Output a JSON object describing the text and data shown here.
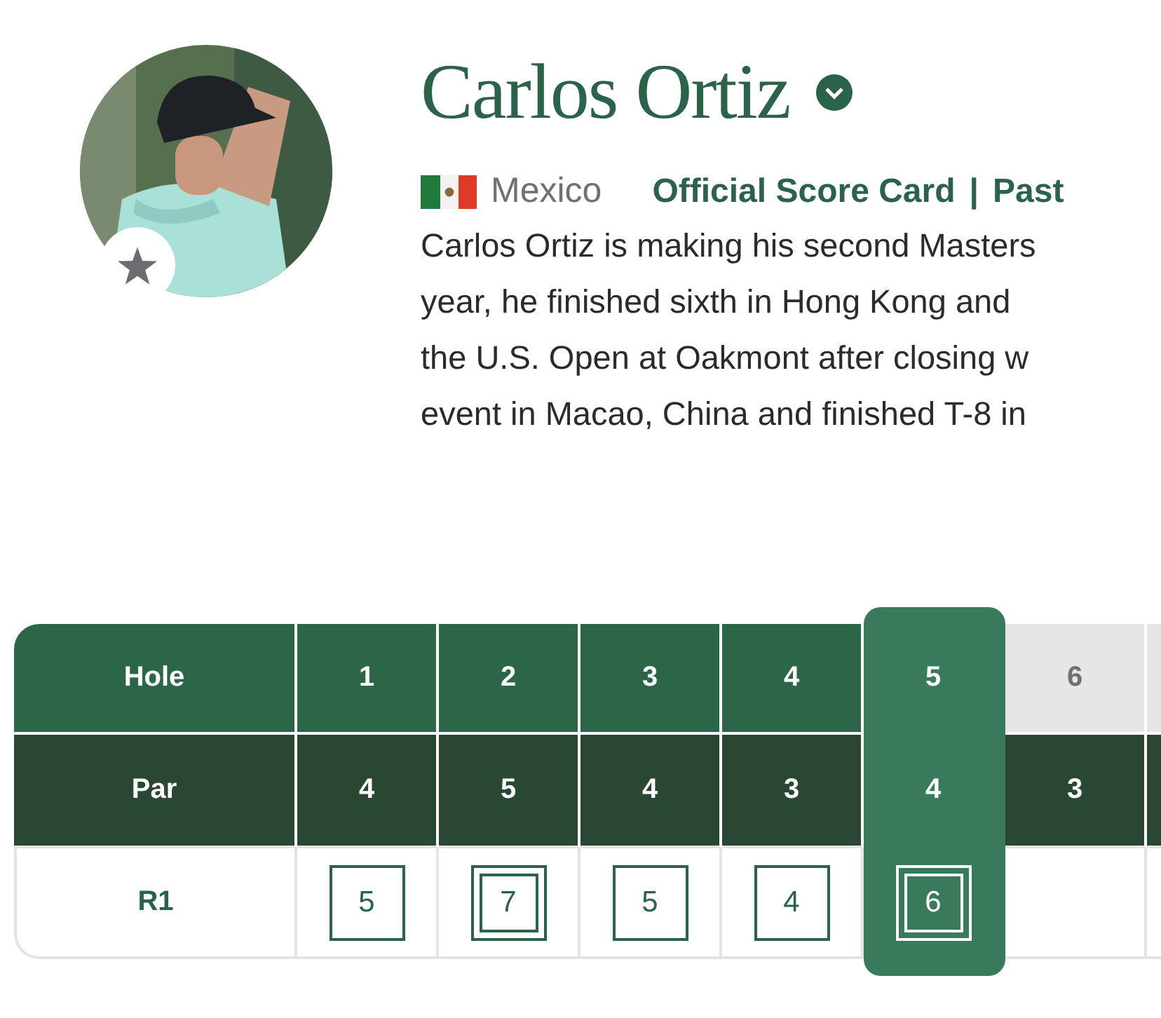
{
  "player": {
    "name": "Carlos Ortiz",
    "country": "Mexico",
    "favorite": false,
    "links": [
      "Official Score Card",
      "Past"
    ],
    "link_separator": "|",
    "bio_lines": [
      "Carlos Ortiz is making his second Masters",
      "year, he finished sixth in Hong Kong and",
      "the U.S. Open at Oakmont after closing w",
      "event in Macao, China and finished T-8 in"
    ]
  },
  "scorecard": {
    "hole_label": "Hole",
    "par_label": "Par",
    "round_label": "R1",
    "holes": [
      {
        "hole": "1",
        "par": "4",
        "score": "5",
        "kind": "single",
        "played": true,
        "selected": false
      },
      {
        "hole": "2",
        "par": "5",
        "score": "7",
        "kind": "double",
        "played": true,
        "selected": false
      },
      {
        "hole": "3",
        "par": "4",
        "score": "5",
        "kind": "single",
        "played": true,
        "selected": false
      },
      {
        "hole": "4",
        "par": "3",
        "score": "4",
        "kind": "single",
        "played": true,
        "selected": false
      },
      {
        "hole": "5",
        "par": "4",
        "score": "6",
        "kind": "double",
        "played": true,
        "selected": true
      },
      {
        "hole": "6",
        "par": "3",
        "played": false,
        "selected": false
      }
    ]
  }
}
